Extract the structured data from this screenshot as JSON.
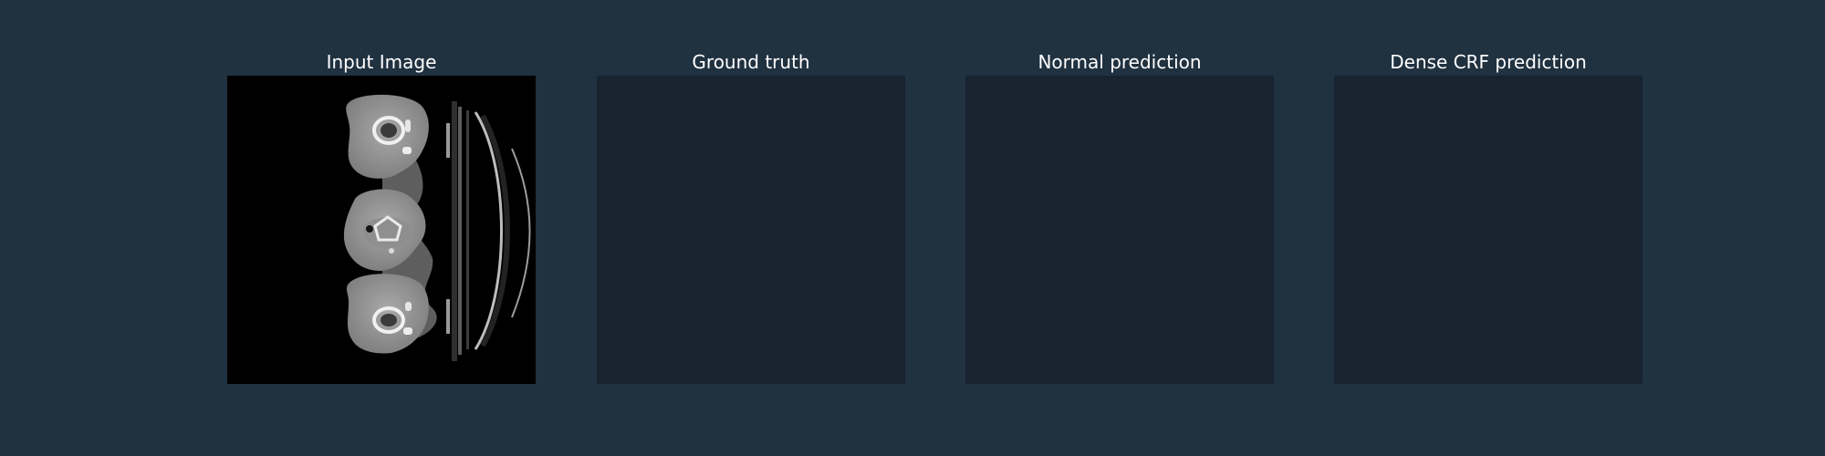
{
  "panels": [
    {
      "title": "Input Image"
    },
    {
      "title": "Ground truth"
    },
    {
      "title": "Normal prediction"
    },
    {
      "title": "Dense CRF prediction"
    }
  ],
  "colors": {
    "background": "#203140",
    "empty_panel": "#17232f",
    "title_text": "#ffffff"
  }
}
